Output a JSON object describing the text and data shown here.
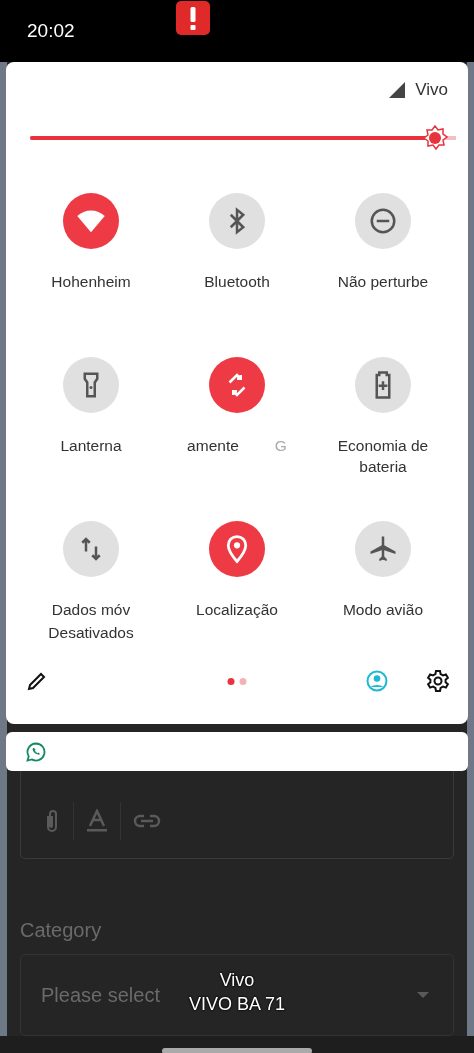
{
  "status_bar": {
    "time": "20:02"
  },
  "quick_settings": {
    "carrier": "Vivo",
    "brightness": {
      "level": 0.98
    },
    "tiles": [
      {
        "label": "Hohenheim",
        "on": true
      },
      {
        "label": "Bluetooth",
        "on": false
      },
      {
        "label": "Não perturbe",
        "on": false
      },
      {
        "label": "Lanterna",
        "on": false
      },
      {
        "label": "amente",
        "marquee_tail": "G",
        "on": true
      },
      {
        "label": "Economia de bateria",
        "on": false
      },
      {
        "label": "Dados móv",
        "secondary": "Desativados",
        "on": false
      },
      {
        "label": "Localização",
        "on": true
      },
      {
        "label": "Modo avião",
        "on": false
      }
    ],
    "page_dots": [
      {
        "selected": true
      },
      {
        "selected": false
      }
    ]
  },
  "background_app": {
    "category_label": "Category",
    "select": {
      "placeholder": "Please select"
    }
  },
  "carrier_toast": {
    "lines": [
      "Vivo",
      "VIVO BA 71"
    ]
  }
}
